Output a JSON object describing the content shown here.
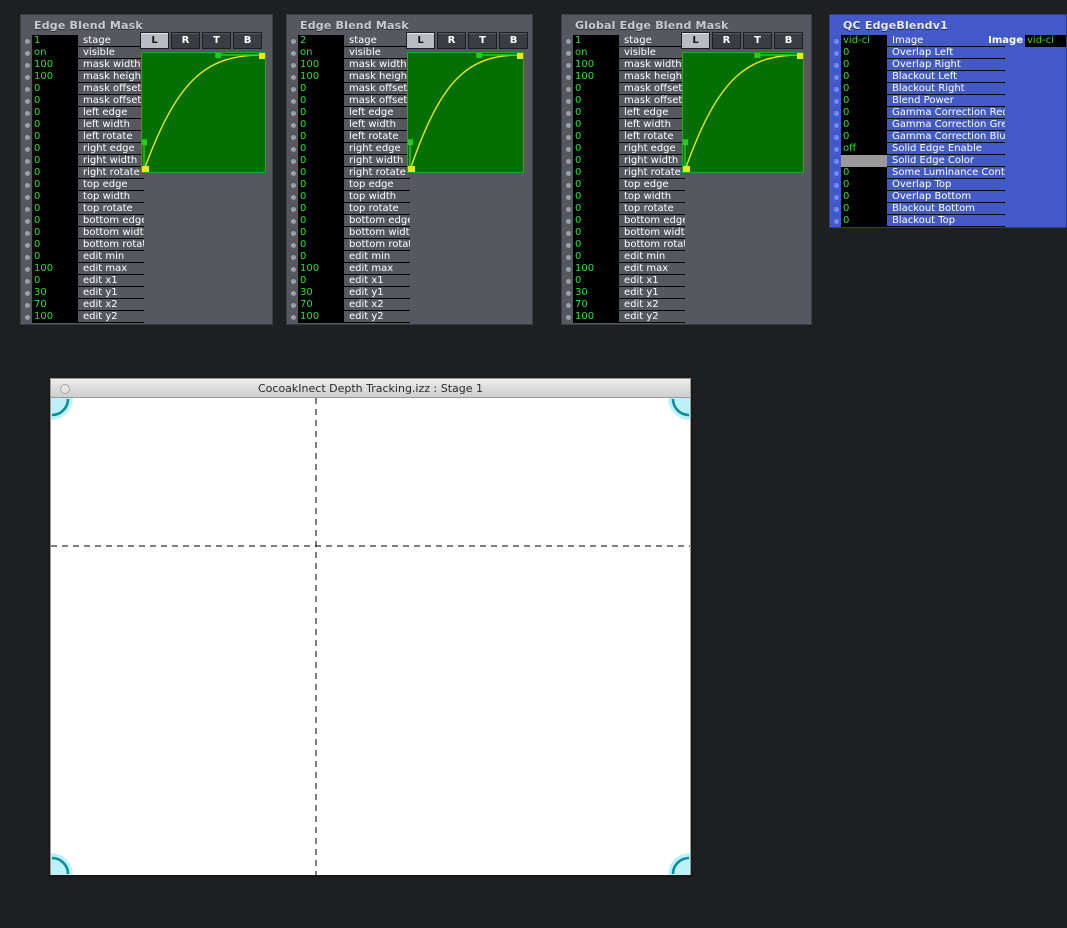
{
  "mask_param_labels": [
    "stage",
    "visible",
    "mask width",
    "mask height",
    "mask offset h",
    "mask offset v",
    "left edge",
    "left width",
    "left rotate",
    "right edge",
    "right width",
    "right rotate",
    "top edge",
    "top width",
    "top rotate",
    "bottom edge",
    "bottom width",
    "bottom rotate",
    "edit min",
    "edit max",
    "edit x1",
    "edit y1",
    "edit x2",
    "edit y2"
  ],
  "panels": [
    {
      "title": "Edge Blend Mask",
      "tabs": [
        "L",
        "R",
        "T",
        "B"
      ],
      "selected_tab": "L",
      "values": [
        "1",
        "on",
        "100",
        "100",
        "0",
        "0",
        "0",
        "0",
        "0",
        "0",
        "0",
        "0",
        "0",
        "0",
        "0",
        "0",
        "0",
        "0",
        "0",
        "100",
        "0",
        "30",
        "70",
        "100"
      ]
    },
    {
      "title": "Edge Blend Mask",
      "tabs": [
        "L",
        "R",
        "T",
        "B"
      ],
      "selected_tab": "L",
      "values": [
        "2",
        "on",
        "100",
        "100",
        "0",
        "0",
        "0",
        "0",
        "0",
        "0",
        "0",
        "0",
        "0",
        "0",
        "0",
        "0",
        "0",
        "0",
        "0",
        "100",
        "0",
        "30",
        "70",
        "100"
      ]
    },
    {
      "title": "Global Edge Blend Mask",
      "tabs": [
        "L",
        "R",
        "T",
        "B"
      ],
      "selected_tab": "L",
      "values": [
        "1",
        "on",
        "100",
        "100",
        "0",
        "0",
        "0",
        "0",
        "0",
        "0",
        "0",
        "0",
        "0",
        "0",
        "0",
        "0",
        "0",
        "0",
        "0",
        "100",
        "0",
        "30",
        "70",
        "100"
      ]
    }
  ],
  "qc": {
    "title": "QC EdgeBlendv1",
    "image_label": "Image",
    "image_value": "vid-ci",
    "rows": [
      {
        "label": "Image",
        "value": "vid-ci",
        "type": "text"
      },
      {
        "label": "Overlap Left",
        "value": "0",
        "type": "text"
      },
      {
        "label": "Overlap Right",
        "value": "0",
        "type": "text"
      },
      {
        "label": "Blackout Left",
        "value": "0",
        "type": "text"
      },
      {
        "label": "Blackout Right",
        "value": "0",
        "type": "text"
      },
      {
        "label": "Blend Power",
        "value": "0",
        "type": "text"
      },
      {
        "label": "Gamma Correction Red",
        "value": "0",
        "type": "text"
      },
      {
        "label": "Gamma Correction Green",
        "value": "0",
        "type": "text"
      },
      {
        "label": "Gamma Correction Blue",
        "value": "0",
        "type": "text"
      },
      {
        "label": "Solid Edge Enable",
        "value": "off",
        "type": "text"
      },
      {
        "label": "Solid Edge Color",
        "value": "",
        "type": "swatch"
      },
      {
        "label": "Some Luminance Control",
        "value": "0",
        "type": "text"
      },
      {
        "label": "Overlap Top",
        "value": "0",
        "type": "text"
      },
      {
        "label": "Overlap Bottom",
        "value": "0",
        "type": "text"
      },
      {
        "label": "Blackout Bottom",
        "value": "0",
        "type": "text"
      },
      {
        "label": "Blackout Top",
        "value": "0",
        "type": "text"
      }
    ]
  },
  "stage_window": {
    "title": "CocoakInect Depth Tracking.izz : Stage 1"
  },
  "colors": {
    "desktop_bg": "#1e1f21",
    "panel_bg": "#55595f",
    "value_bg": "#000000",
    "value_text": "#29e02b",
    "qc_bg": "#4359c8",
    "graph_fill": "#047004",
    "graph_border": "#22aa22",
    "curve": "#e8e81c",
    "handle": "#22cc22",
    "corner_marker": "#bdf0f7",
    "corner_arc": "#0e8ca0"
  }
}
